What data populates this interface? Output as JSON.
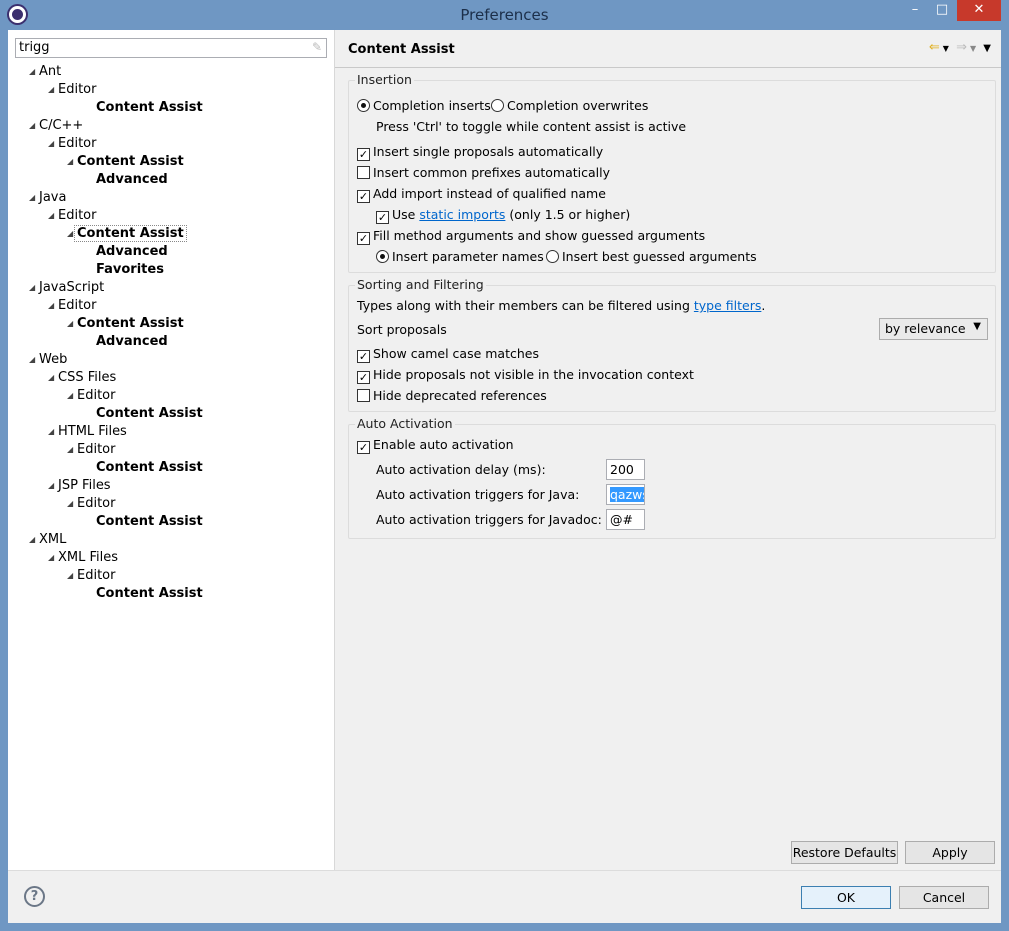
{
  "window": {
    "title": "Preferences",
    "minimize": "–",
    "maximize": "□",
    "close": "✕",
    "accent": "#6f97c3"
  },
  "search": {
    "value": "trigg",
    "clear_icon": "eraser-icon"
  },
  "tree": [
    {
      "label": "Ant",
      "level": 0,
      "expanded": true,
      "bold": false
    },
    {
      "label": "Editor",
      "level": 1,
      "expanded": true,
      "bold": false
    },
    {
      "label": "Content Assist",
      "level": 3,
      "expanded": null,
      "bold": true
    },
    {
      "label": "C/C++",
      "level": 0,
      "expanded": true,
      "bold": false
    },
    {
      "label": "Editor",
      "level": 1,
      "expanded": true,
      "bold": false
    },
    {
      "label": "Content Assist",
      "level": 2,
      "expanded": true,
      "bold": true
    },
    {
      "label": "Advanced",
      "level": 3,
      "expanded": null,
      "bold": true
    },
    {
      "label": "Java",
      "level": 0,
      "expanded": true,
      "bold": false
    },
    {
      "label": "Editor",
      "level": 1,
      "expanded": true,
      "bold": false
    },
    {
      "label": "Content Assist",
      "level": 2,
      "expanded": true,
      "bold": true,
      "selected": true
    },
    {
      "label": "Advanced",
      "level": 3,
      "expanded": null,
      "bold": true
    },
    {
      "label": "Favorites",
      "level": 3,
      "expanded": null,
      "bold": true
    },
    {
      "label": "JavaScript",
      "level": 0,
      "expanded": true,
      "bold": false
    },
    {
      "label": "Editor",
      "level": 1,
      "expanded": true,
      "bold": false
    },
    {
      "label": "Content Assist",
      "level": 2,
      "expanded": true,
      "bold": true
    },
    {
      "label": "Advanced",
      "level": 3,
      "expanded": null,
      "bold": true
    },
    {
      "label": "Web",
      "level": 0,
      "expanded": true,
      "bold": false
    },
    {
      "label": "CSS Files",
      "level": 1,
      "expanded": true,
      "bold": false
    },
    {
      "label": "Editor",
      "level": 2,
      "expanded": true,
      "bold": false
    },
    {
      "label": "Content Assist",
      "level": 3,
      "expanded": null,
      "bold": true
    },
    {
      "label": "HTML Files",
      "level": 1,
      "expanded": true,
      "bold": false
    },
    {
      "label": "Editor",
      "level": 2,
      "expanded": true,
      "bold": false
    },
    {
      "label": "Content Assist",
      "level": 3,
      "expanded": null,
      "bold": true
    },
    {
      "label": "JSP Files",
      "level": 1,
      "expanded": true,
      "bold": false
    },
    {
      "label": "Editor",
      "level": 2,
      "expanded": true,
      "bold": false
    },
    {
      "label": "Content Assist",
      "level": 3,
      "expanded": null,
      "bold": true
    },
    {
      "label": "XML",
      "level": 0,
      "expanded": true,
      "bold": false
    },
    {
      "label": "XML Files",
      "level": 1,
      "expanded": true,
      "bold": false
    },
    {
      "label": "Editor",
      "level": 2,
      "expanded": true,
      "bold": false
    },
    {
      "label": "Content Assist",
      "level": 3,
      "expanded": null,
      "bold": true
    }
  ],
  "page": {
    "title": "Content Assist"
  },
  "insertion": {
    "title": "Insertion",
    "completion_inserts": "Completion inserts",
    "completion_overwrites": "Completion overwrites",
    "hint": "Press 'Ctrl' to toggle while content assist is active",
    "single_proposals": "Insert single proposals automatically",
    "common_prefixes": "Insert common prefixes automatically",
    "add_import": "Add import instead of qualified name",
    "use": "Use",
    "static_imports": "static imports",
    "static_suffix": "(only 1.5 or higher)",
    "fill_args": "Fill method arguments and show guessed arguments",
    "param_names": "Insert parameter names",
    "best_guessed": "Insert best guessed arguments"
  },
  "sorting": {
    "title": "Sorting and Filtering",
    "desc": "Types along with their members can be filtered using",
    "type_filters": "type filters",
    "period": ".",
    "sort_label": "Sort proposals",
    "sort_value": "by relevance",
    "camel": "Show camel case matches",
    "hide_not_visible": "Hide proposals not visible in the invocation context",
    "hide_deprecated": "Hide deprecated references"
  },
  "auto": {
    "title": "Auto Activation",
    "enable": "Enable auto activation",
    "delay_label": "Auto activation delay (ms):",
    "delay": "200",
    "java_label": "Auto activation triggers for Java:",
    "java": "qazws",
    "javadoc_label": "Auto activation triggers for Javadoc:",
    "javadoc": "@#"
  },
  "buttons": {
    "restore": "Restore Defaults",
    "apply": "Apply",
    "ok": "OK",
    "cancel": "Cancel",
    "help": "?"
  }
}
